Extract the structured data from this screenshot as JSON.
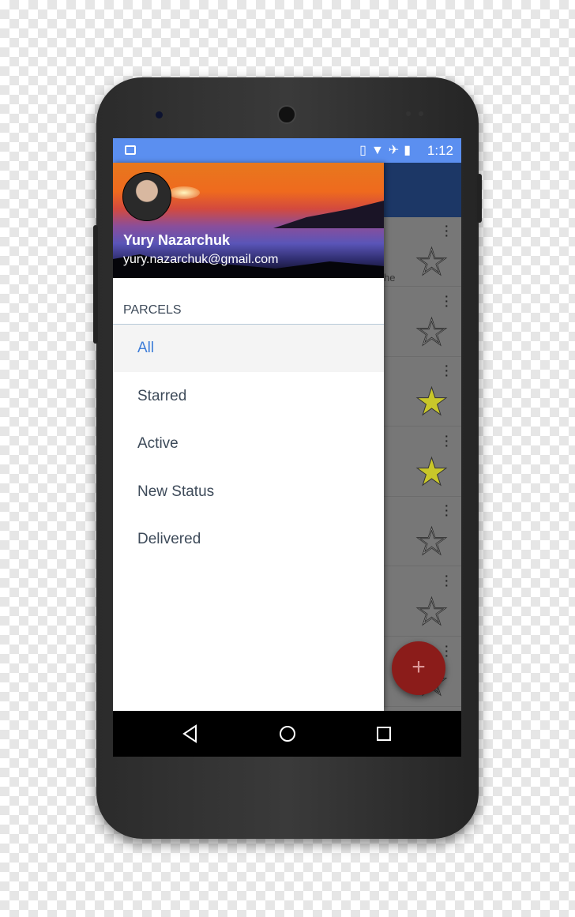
{
  "status_bar": {
    "time": "1:12",
    "icons": [
      "image-icon",
      "vibrate-icon",
      "wifi-icon",
      "airplane-icon",
      "battery-icon"
    ]
  },
  "drawer": {
    "user": {
      "name": "Yury Nazarchuk",
      "email": "yury.nazarchuk@gmail.com"
    },
    "section_title": "PARCELS",
    "items": [
      {
        "label": "All",
        "selected": true
      },
      {
        "label": "Starred"
      },
      {
        "label": "Active"
      },
      {
        "label": "New Status"
      },
      {
        "label": "Delivered"
      }
    ]
  },
  "list": {
    "partial_text": "he",
    "rows": [
      {
        "starred": false
      },
      {
        "starred": false
      },
      {
        "starred": true
      },
      {
        "starred": true
      },
      {
        "starred": false
      },
      {
        "starred": false
      },
      {
        "starred": false
      }
    ]
  },
  "fab": {
    "label": "+"
  },
  "colors": {
    "status_bar": "#5b8ff0",
    "app_bar": "#1c3766",
    "accent": "#3f7ed8",
    "fab": "#c62828",
    "star": "#c9c72a"
  }
}
